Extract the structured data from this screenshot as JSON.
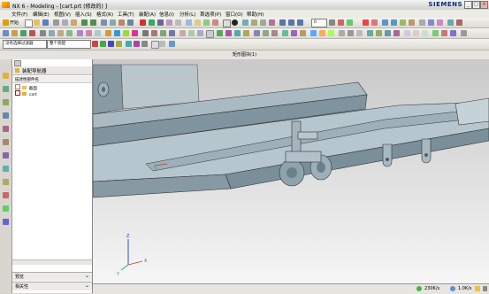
{
  "window": {
    "title": "NX 6 - Modeling - [cart.prt (修改的) ]",
    "brand": "SIEMENS",
    "controls": [
      "_",
      "□",
      "×"
    ]
  },
  "menubar": {
    "items": [
      "文件(F)",
      "编辑(E)",
      "视图(V)",
      "插入(S)",
      "格式(R)",
      "工具(T)",
      "装配(A)",
      "信息(I)",
      "分析(L)",
      "首选项(P)",
      "窗口(O)",
      "帮助(H)"
    ]
  },
  "toolbar": {
    "start_label": "开始",
    "zoom_value": "0",
    "filter_combo": "没有选择过滤器",
    "assembly_combo": "整个装配"
  },
  "command_bar": {
    "title": "矩形图块(1)"
  },
  "navigator": {
    "title": "装配导航器",
    "column_header": "描述性部件名",
    "items": [
      {
        "label": "截面"
      },
      {
        "label": "cart"
      }
    ],
    "panel_preview": "预览",
    "panel_dependencies": "相关性"
  },
  "viewport": {
    "axis_labels": [
      "X",
      "Y",
      "Z"
    ],
    "colors": {
      "frame": "#9fb3bf",
      "frame_shade": "#6f8794",
      "edge": "#2a2a2a"
    }
  },
  "status": {
    "memory": "230K/s",
    "speed": "1.0K/s"
  }
}
